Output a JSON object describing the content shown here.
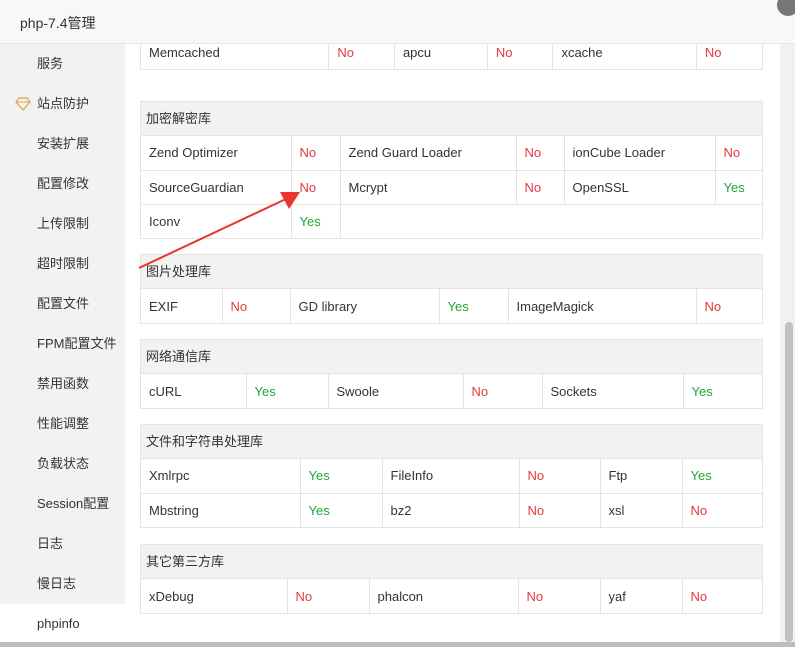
{
  "window": {
    "title": "php-7.4管理"
  },
  "sidebar": {
    "items": [
      {
        "label": "服务"
      },
      {
        "label": "站点防护",
        "icon": "diamond-icon"
      },
      {
        "label": "安装扩展"
      },
      {
        "label": "配置修改"
      },
      {
        "label": "上传限制"
      },
      {
        "label": "超时限制"
      },
      {
        "label": "配置文件"
      },
      {
        "label": "FPM配置文件"
      },
      {
        "label": "禁用函数"
      },
      {
        "label": "性能调整"
      },
      {
        "label": "负载状态"
      },
      {
        "label": "Session配置"
      },
      {
        "label": "日志"
      },
      {
        "label": "慢日志"
      },
      {
        "label": "phpinfo"
      }
    ],
    "active_index": 14
  },
  "colors": {
    "yes": "#20a53a",
    "no": "#e4393c",
    "arrow": "#e8352e"
  },
  "sections": {
    "cache": {
      "rows": [
        [
          {
            "v": "Memcached"
          },
          {
            "v": "No",
            "s": "no"
          },
          {
            "v": "apcu"
          },
          {
            "v": "No",
            "s": "no"
          },
          {
            "v": "xcache"
          },
          {
            "v": "No",
            "s": "no"
          }
        ]
      ]
    },
    "crypto": {
      "title": "加密解密库",
      "rows": [
        [
          {
            "v": "Zend Optimizer"
          },
          {
            "v": "No",
            "s": "no"
          },
          {
            "v": "Zend Guard Loader"
          },
          {
            "v": "No",
            "s": "no"
          },
          {
            "v": "ionCube Loader"
          },
          {
            "v": "No",
            "s": "no"
          }
        ],
        [
          {
            "v": "SourceGuardian"
          },
          {
            "v": "No",
            "s": "no"
          },
          {
            "v": "Mcrypt"
          },
          {
            "v": "No",
            "s": "no"
          },
          {
            "v": "OpenSSL"
          },
          {
            "v": "Yes",
            "s": "yes"
          }
        ],
        [
          {
            "v": "Iconv"
          },
          {
            "v": "Yes",
            "s": "yes"
          },
          {
            "v": ""
          }
        ]
      ]
    },
    "image": {
      "title": "图片处理库",
      "rows": [
        [
          {
            "v": "EXIF"
          },
          {
            "v": "No",
            "s": "no"
          },
          {
            "v": "GD library"
          },
          {
            "v": "Yes",
            "s": "yes"
          },
          {
            "v": "ImageMagick"
          },
          {
            "v": "No",
            "s": "no"
          }
        ]
      ]
    },
    "network": {
      "title": "网络通信库",
      "rows": [
        [
          {
            "v": "cURL"
          },
          {
            "v": "Yes",
            "s": "yes"
          },
          {
            "v": "Swoole"
          },
          {
            "v": "No",
            "s": "no"
          },
          {
            "v": "Sockets"
          },
          {
            "v": "Yes",
            "s": "yes"
          }
        ]
      ]
    },
    "files": {
      "title": "文件和字符串处理库",
      "rows": [
        [
          {
            "v": "Xmlrpc"
          },
          {
            "v": "Yes",
            "s": "yes"
          },
          {
            "v": "FileInfo"
          },
          {
            "v": "No",
            "s": "no"
          },
          {
            "v": "Ftp"
          },
          {
            "v": "Yes",
            "s": "yes"
          }
        ],
        [
          {
            "v": "Mbstring"
          },
          {
            "v": "Yes",
            "s": "yes"
          },
          {
            "v": "bz2"
          },
          {
            "v": "No",
            "s": "no"
          },
          {
            "v": "xsl"
          },
          {
            "v": "No",
            "s": "no"
          }
        ]
      ]
    },
    "thirdparty": {
      "title": "其它第三方库",
      "rows": [
        [
          {
            "v": "xDebug"
          },
          {
            "v": "No",
            "s": "no"
          },
          {
            "v": "phalcon"
          },
          {
            "v": "No",
            "s": "no"
          },
          {
            "v": "yaf"
          },
          {
            "v": "No",
            "s": "no"
          }
        ]
      ]
    }
  }
}
